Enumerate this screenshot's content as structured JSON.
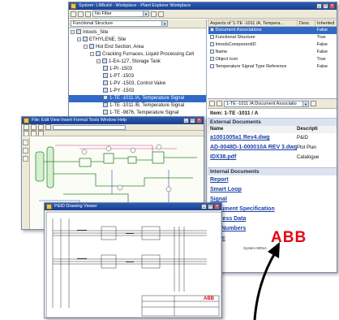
{
  "explorer": {
    "title": "System: LNBuild - Workplace - Plant Explorer Workplace",
    "filter_label": "No Filter",
    "structure_label": "Functional Structure",
    "tree": [
      {
        "label": "Intools_Site",
        "indent": 1,
        "sel": false
      },
      {
        "label": "ETHYLENE, Site",
        "indent": 2,
        "sel": false
      },
      {
        "label": "Hot End Section, Area",
        "indent": 3,
        "sel": false
      },
      {
        "label": "Cracking Furnaces, Liquid Processing Cell",
        "indent": 4,
        "sel": false
      },
      {
        "label": "1-EA-127, Storage Tank",
        "indent": 5,
        "sel": false
      },
      {
        "label": "1-PI -1503",
        "indent": 6,
        "sel": false
      },
      {
        "label": "1-PT -1503",
        "indent": 6,
        "sel": false
      },
      {
        "label": "1-PV -1503, Control Valve",
        "indent": 6,
        "sel": false
      },
      {
        "label": "1-PY -1503",
        "indent": 6,
        "sel": false
      },
      {
        "label": "1-TE -1011 /A, Temperature Signal",
        "indent": 6,
        "sel": true
      },
      {
        "label": "1-TE -1011 /B, Temperature Signal",
        "indent": 6,
        "sel": false
      },
      {
        "label": "1-TE -9876, Temperature Signal",
        "indent": 6,
        "sel": false
      },
      {
        "label": "1-TIC -1011, Temperature Control",
        "indent": 6,
        "sel": false
      }
    ],
    "aspects_header": "Aspects of '1-TE -1011 /A, Tempera...",
    "aspect_cols": [
      "",
      "Desc",
      "Inherited"
    ],
    "aspects": [
      {
        "name": "Document Associations",
        "desc": "",
        "inh": "False",
        "sel": true
      },
      {
        "name": "Functional Structure",
        "desc": "",
        "inh": "True",
        "sel": false
      },
      {
        "name": "IntoolsComponentID",
        "desc": "",
        "inh": "False",
        "sel": false
      },
      {
        "name": "Name",
        "desc": "",
        "inh": "False",
        "sel": false
      },
      {
        "name": "Object Icon",
        "desc": "",
        "inh": "True",
        "sel": false
      },
      {
        "name": "Temperature Signal Type Reference",
        "desc": "",
        "inh": "False",
        "sel": false
      }
    ],
    "preview_combo": "1-TE -1011 /A:Document Associatio",
    "item_label": "Item: 1-TE -1011 / A",
    "external_header": "External Documents",
    "ext_cols": [
      "Name",
      "Descripti"
    ],
    "external_docs": [
      {
        "name": "a1001005a1 Rev4.dwg",
        "desc": "P&ID"
      },
      {
        "name": "AD-0048D-1-000010A REV 3.dwg",
        "desc": "Plot Plan"
      },
      {
        "name": "IDX38.pdf",
        "desc": "Catalogue"
      }
    ],
    "internal_header": "Internal Documents",
    "internal_docs": [
      "Report",
      "Smart Loop",
      "Signal",
      "Document Specification",
      "Process Data",
      "Tag Numbers",
      "Logic"
    ]
  },
  "pid_window": {
    "title": "File: Edit View Insert Format Tools Window Help"
  },
  "drawing_window": {
    "title": "P&ID Drawing Viewer",
    "stamp": "ABB"
  },
  "brand": {
    "logo": "ABB",
    "logo_sub": "System 800xA"
  },
  "colors": {
    "accent": "#316ac5",
    "brand": "#e30613"
  }
}
